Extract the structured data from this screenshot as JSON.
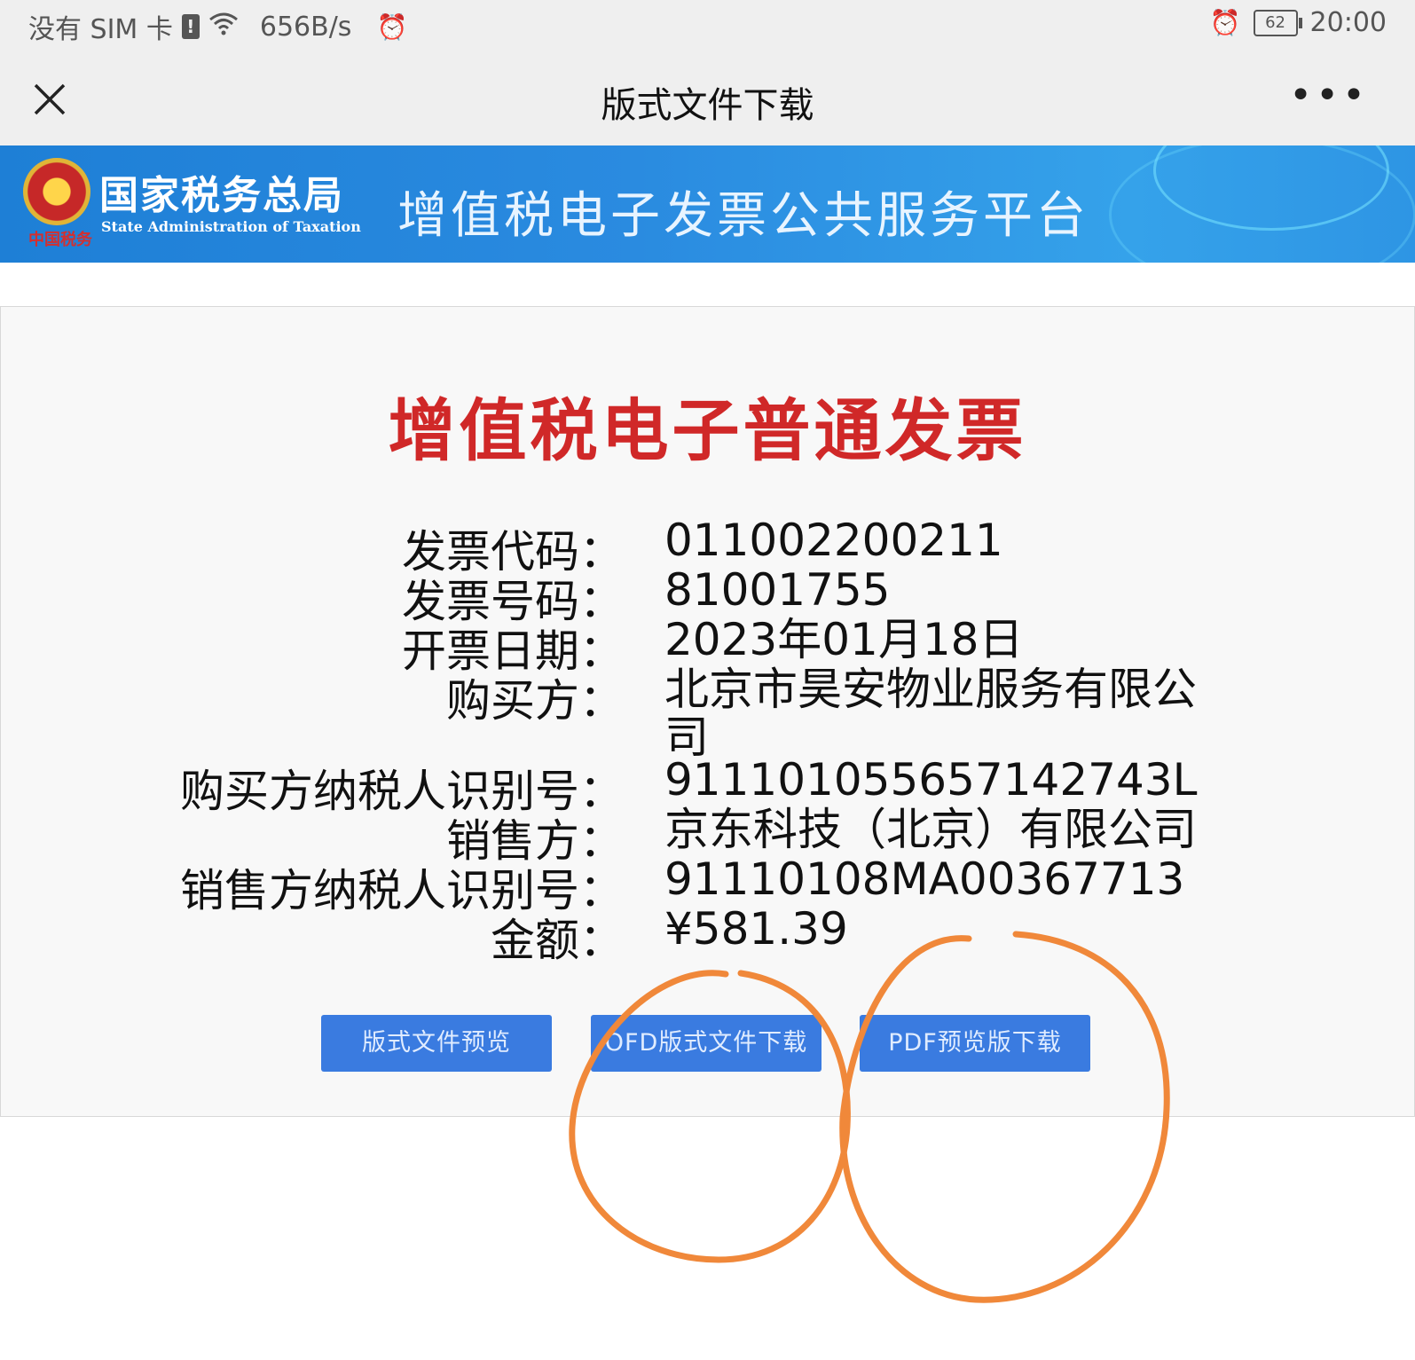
{
  "status_bar": {
    "carrier": "没有 SIM 卡",
    "sim_alert": "!",
    "speed": "656B/s",
    "battery": "62",
    "time": "20:00"
  },
  "nav": {
    "title": "版式文件下载",
    "more": "•••"
  },
  "banner": {
    "org_name": "国家税务总局",
    "org_en": "State Administration of Taxation",
    "emblem_caption": "中国税务",
    "platform": "增值税电子发票公共服务平台"
  },
  "invoice": {
    "title": "增值税电子普通发票",
    "fields": [
      {
        "label": "发票代码：",
        "value": "011002200211"
      },
      {
        "label": "发票号码：",
        "value": "81001755"
      },
      {
        "label": "开票日期：",
        "value": "2023年01月18日"
      },
      {
        "label": "购买方：",
        "value": "北京市昊安物业服务有限公司"
      },
      {
        "label": "购买方纳税人识别号：",
        "value": "911101055657142743L"
      },
      {
        "label": "销售方：",
        "value": "京东科技（北京）有限公司"
      },
      {
        "label": "销售方纳税人识别号：",
        "value": "91110108MA00367713"
      },
      {
        "label": "金额：",
        "value": "¥581.39"
      }
    ]
  },
  "buttons": {
    "preview": "版式文件预览",
    "ofd_download": "OFD版式文件下载",
    "pdf_download": "PDF预览版下载"
  },
  "colors": {
    "title_red": "#d02828",
    "button_blue": "#3a7be0",
    "annotation_orange": "#f0883a"
  }
}
